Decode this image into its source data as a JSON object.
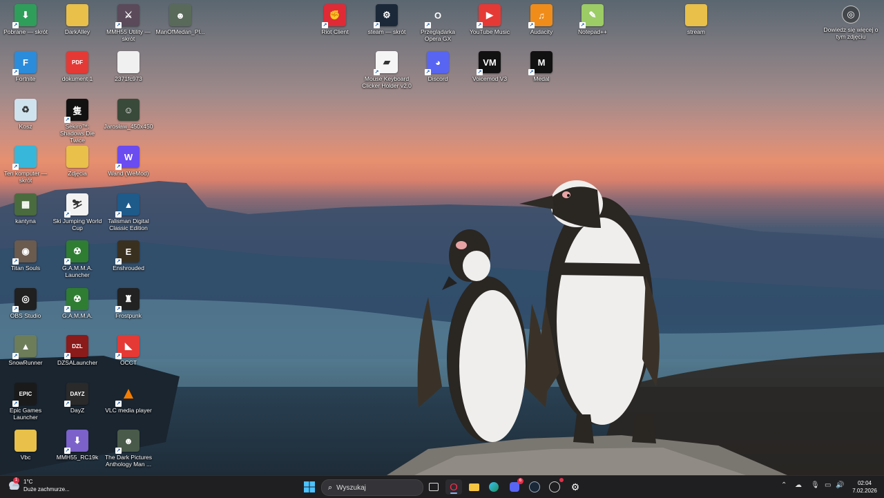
{
  "desktop_icons": [
    {
      "label": "Pobrane — skrót",
      "glyph": "⬇",
      "bg": "#2e9e5a",
      "sc": true
    },
    {
      "label": "Fortnite",
      "glyph": "F",
      "bg": "#2b8cdb",
      "sc": true
    },
    {
      "label": "Kosz",
      "glyph": "♻",
      "bg": "#cfe3ef",
      "sc": false
    },
    {
      "label": "Ten komputer — skrót",
      "glyph": "",
      "bg": "#37b7d9",
      "sc": true
    },
    {
      "label": "kantyna",
      "glyph": "▦",
      "bg": "#4a6b3e",
      "sc": false
    },
    {
      "label": "Titan Souls",
      "glyph": "◉",
      "bg": "#6b5a4e",
      "sc": true
    },
    {
      "label": "OBS Studio",
      "glyph": "◎",
      "bg": "#202020",
      "sc": true
    },
    {
      "label": "SnowRunner",
      "glyph": "▲",
      "bg": "#6d7d5a",
      "sc": true
    },
    {
      "label": "Epic Games Launcher",
      "glyph": "EPIC",
      "bg": "#1a1a1a",
      "sc": true
    },
    {
      "label": "Vbc",
      "glyph": "",
      "bg": "#e8c04a",
      "sc": false
    },
    {
      "label": "DarkAlley",
      "glyph": "",
      "bg": "#e8c04a",
      "sc": false
    },
    {
      "label": "dokument 1",
      "glyph": "PDF",
      "bg": "#e53935",
      "sc": false
    },
    {
      "label": "Sekiro™: Shadows Die Twice",
      "glyph": "隻",
      "bg": "#111",
      "sc": true
    },
    {
      "label": "Zdjęcia",
      "glyph": "",
      "bg": "#e8c04a",
      "sc": false
    },
    {
      "label": "Ski Jumping World Cup",
      "glyph": "⛷",
      "bg": "#f2f2f2",
      "sc": true
    },
    {
      "label": "G.A.M.M.A. Launcher",
      "glyph": "☢",
      "bg": "#2e7d32",
      "sc": true
    },
    {
      "label": "G.A.M.M.A.",
      "glyph": "☢",
      "bg": "#2e7d32",
      "sc": true
    },
    {
      "label": "DZSALauncher",
      "glyph": "DZL",
      "bg": "#8b1a1a",
      "sc": true
    },
    {
      "label": "DayZ",
      "glyph": "DAYZ",
      "bg": "#2a2a2a",
      "sc": true
    },
    {
      "label": "MMH55_RC19k",
      "glyph": "⬇",
      "bg": "#7b61c9",
      "sc": true
    },
    {
      "label": "MMH55 Utility — skrót",
      "glyph": "⚔",
      "bg": "#5a4a5a",
      "sc": true
    },
    {
      "label": "2371fc973",
      "glyph": "",
      "bg": "#f0f0f0",
      "sc": false
    },
    {
      "label": "Jarosław_450x450",
      "glyph": "☺",
      "bg": "#3a4a3a",
      "sc": false
    },
    {
      "label": "Wand (WeMod)",
      "glyph": "W",
      "bg": "#6a4cf0",
      "sc": true
    },
    {
      "label": "Talisman Digital Classic Edition",
      "glyph": "▲",
      "bg": "#1e5a8a",
      "sc": true
    },
    {
      "label": "Enshrouded",
      "glyph": "E",
      "bg": "#3a3020",
      "sc": true
    },
    {
      "label": "Frostpunk",
      "glyph": "♜",
      "bg": "#222",
      "sc": true
    },
    {
      "label": "OCCT",
      "glyph": "◣",
      "bg": "#e53935",
      "sc": true
    },
    {
      "label": "VLC media player",
      "glyph": "▲",
      "bg": "transparent",
      "sc": true
    },
    {
      "label": "The Dark Pictures Anthology Man ...",
      "glyph": "☻",
      "bg": "#4a5a4a",
      "sc": true
    },
    {
      "label": "ManOfMedan_Pl...",
      "glyph": "☻",
      "bg": "#5a6a5a",
      "sc": false
    },
    {
      "label": "Riot Client",
      "glyph": "✊",
      "bg": "#e02a36",
      "sc": true
    },
    {
      "label": "steam — skrót",
      "glyph": "⚙",
      "bg": "#1b2838",
      "sc": true
    },
    {
      "label": "Mouse Keyboard Clicker Holder v2.0",
      "glyph": "▰",
      "bg": "#f5f5f5",
      "sc": true
    },
    {
      "label": "Przeglądarka Opera GX",
      "glyph": "O",
      "bg": "transparent",
      "sc": true
    },
    {
      "label": "Discord",
      "glyph": "◕",
      "bg": "#5865f2",
      "sc": true
    },
    {
      "label": "YouTube Music",
      "glyph": "▶",
      "bg": "#e53935",
      "sc": true
    },
    {
      "label": "Voicemod V3",
      "glyph": "VM",
      "bg": "#111",
      "sc": true
    },
    {
      "label": "Audacity",
      "glyph": "♫",
      "bg": "#f08c1a",
      "sc": true
    },
    {
      "label": "Medal",
      "glyph": "M",
      "bg": "#111",
      "sc": true
    },
    {
      "label": "Notepad++",
      "glyph": "✎",
      "bg": "#9ccc65",
      "sc": true
    },
    {
      "label": "stream",
      "glyph": "",
      "bg": "#e8c04a",
      "sc": false
    }
  ],
  "learn_more": {
    "label": "Dowiedz się więcej o tym zdjęciu",
    "icon": "camera-icon"
  },
  "taskbar": {
    "weather": {
      "temp": "1°C",
      "desc": "Duże zachmurze...",
      "badge": "1"
    },
    "search_placeholder": "Wyszukaj",
    "discord_badge": "6",
    "clock": {
      "time": "02:04",
      "date": "7.02.2026"
    }
  }
}
